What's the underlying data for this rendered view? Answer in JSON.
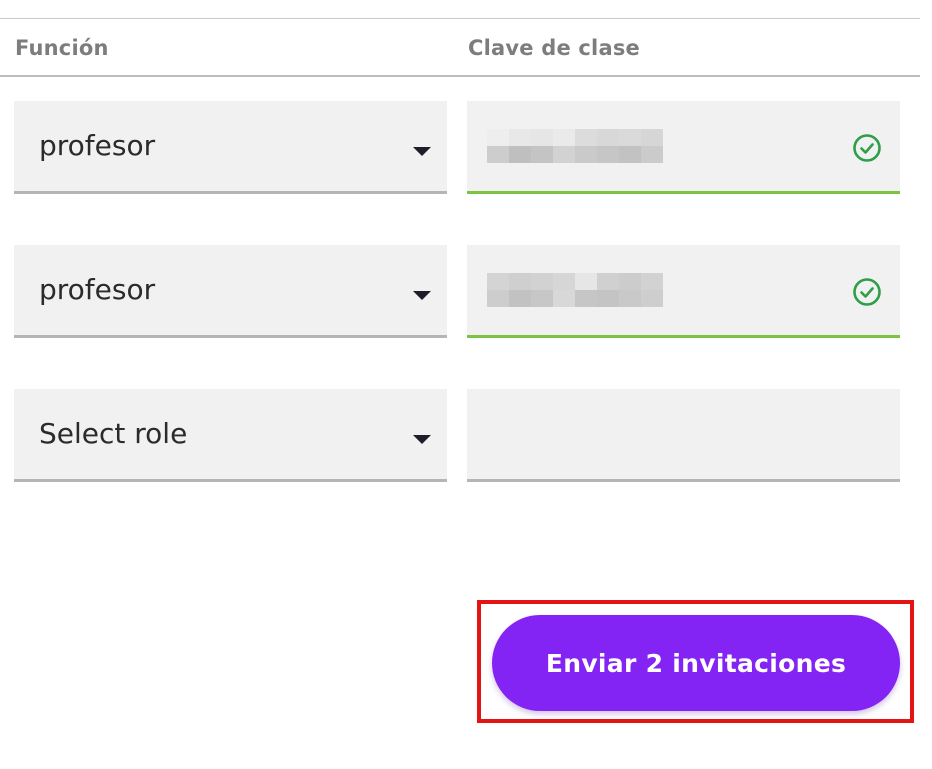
{
  "headers": {
    "role": "Función",
    "class_key": "Clave de clase"
  },
  "rows": [
    {
      "role": "profesor",
      "key_state": "valid",
      "key_value": "[redacted]"
    },
    {
      "role": "profesor",
      "key_state": "valid",
      "key_value": "[redacted]"
    },
    {
      "role": "Select role",
      "key_state": "empty",
      "key_value": ""
    }
  ],
  "icons": {
    "dropdown": "caret-down-icon",
    "valid": "check-circle-icon"
  },
  "colors": {
    "accent_button": "#8424f4",
    "valid_underline": "#7cc243",
    "valid_icon": "#2e9e48",
    "highlight": "#e41414"
  },
  "submit": {
    "label": "Enviar 2 invitaciones"
  }
}
